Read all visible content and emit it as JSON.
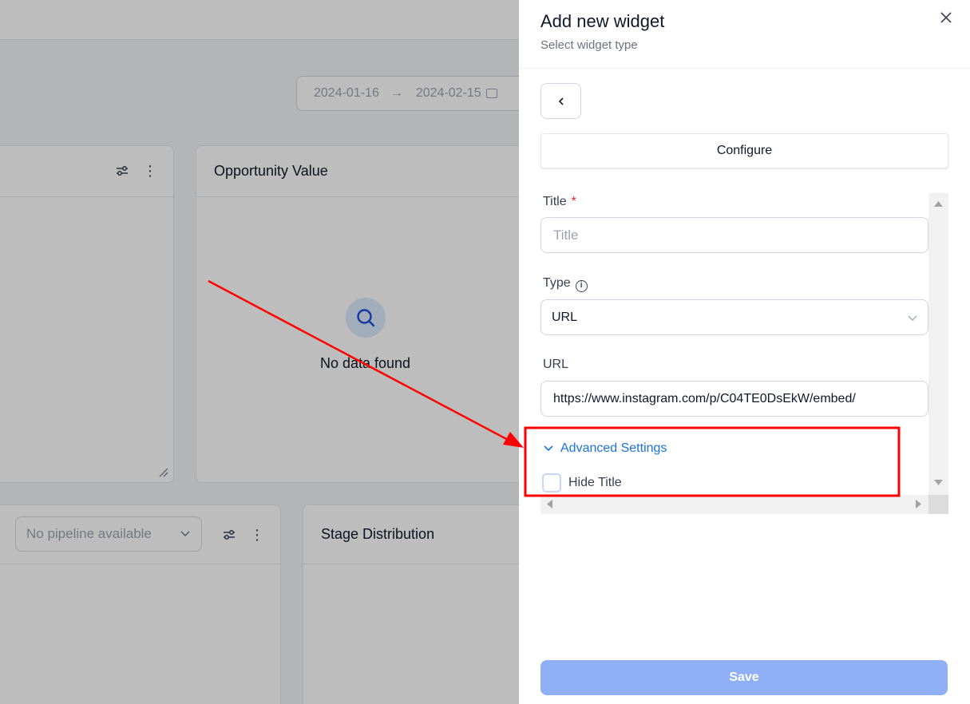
{
  "background": {
    "date_range": {
      "start": "2024-01-16",
      "end": "2024-02-15"
    },
    "cards": {
      "opportunity_value": {
        "title": "Opportunity Value",
        "empty_text": "No data found"
      },
      "stage_distribution": {
        "title": "Stage Distribution"
      },
      "pipeline_select": {
        "placeholder": "No pipeline available"
      }
    }
  },
  "drawer": {
    "title": "Add new widget",
    "subtitle": "Select widget type",
    "tab_label": "Configure",
    "form": {
      "title_label": "Title",
      "required_mark": "*",
      "title_placeholder": "Title",
      "type_label": "Type",
      "type_value": "URL",
      "url_label": "URL",
      "url_value": "https://www.instagram.com/p/C04TE0DsEkW/embed/",
      "advanced_settings": "Advanced Settings",
      "hide_title_label": "Hide Title",
      "hide_title_checked": false
    },
    "save_label": "Save"
  },
  "colors": {
    "accent": "#1a73e8",
    "save_disabled": "#8fb0f7",
    "annotation": "#ff0000"
  }
}
